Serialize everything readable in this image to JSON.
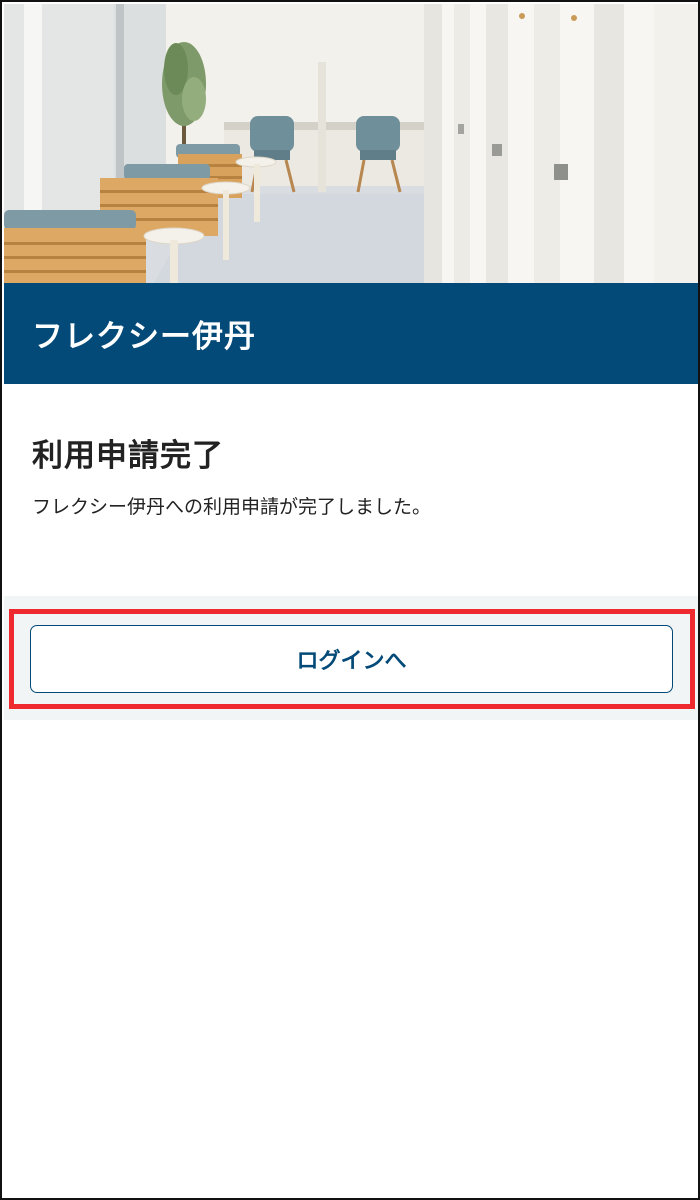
{
  "header": {
    "title": "フレクシー伊丹"
  },
  "main": {
    "heading": "利用申請完了",
    "message": "フレクシー伊丹への利用申請が完了しました。",
    "login_button_label": "ログインへ"
  },
  "colors": {
    "brand": "#034a78",
    "highlight": "#ee2a2f",
    "button_area_bg": "#f2f5f5"
  }
}
